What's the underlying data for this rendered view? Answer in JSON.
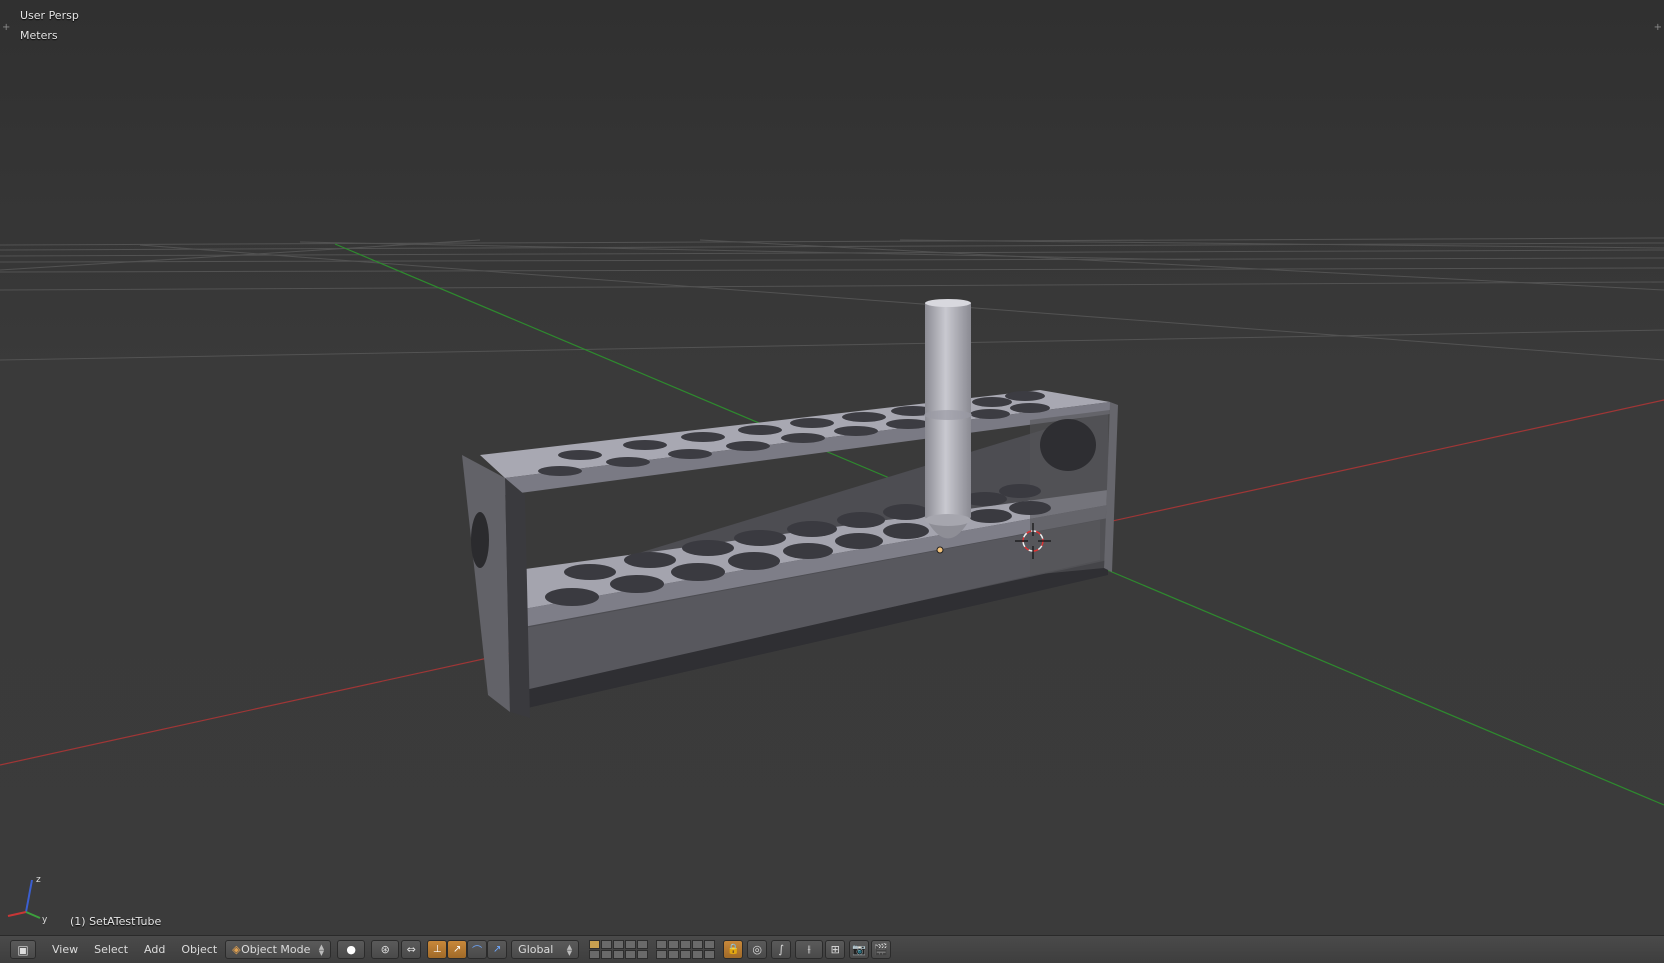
{
  "viewport": {
    "view_name": "User Persp",
    "units": "Meters",
    "object_info": "(1) SetATestTube"
  },
  "header": {
    "menus": [
      "View",
      "Select",
      "Add",
      "Object"
    ],
    "mode": "Object Mode",
    "orientation": "Global"
  },
  "colors": {
    "x_axis": "#a03636",
    "y_axis": "#2e8a2e",
    "grid": "#5a5a5a",
    "object": "#9a9aa4",
    "accent": "#c8883a"
  }
}
